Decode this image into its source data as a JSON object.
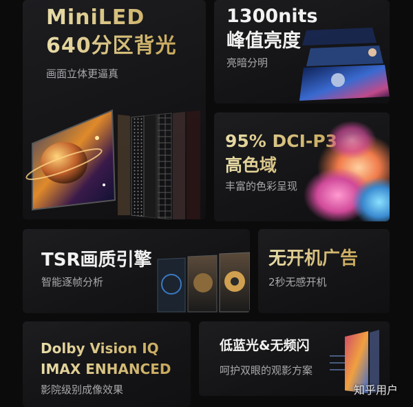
{
  "features": [
    {
      "title_line1": "MiniLED",
      "title_line2": "640分区背光",
      "subtitle": "画面立体更逼真"
    },
    {
      "title_line1": "1300nits",
      "title_line2": "峰值亮度",
      "subtitle": "亮暗分明"
    },
    {
      "title_line1": "95% DCI-P3",
      "title_line2": "高色域",
      "subtitle": "丰富的色彩呈现"
    },
    {
      "title": "TSR画质引擎",
      "subtitle": "智能逐帧分析"
    },
    {
      "title": "无开机广告",
      "subtitle": "2秒无感开机"
    },
    {
      "title_line1": "Dolby Vision IQ",
      "title_line2": "IMAX ENHANCED",
      "subtitle": "影院级别成像效果"
    },
    {
      "title": "低蓝光&无频闪",
      "subtitle": "呵护双眼的观影方案"
    }
  ],
  "watermark": "知乎用户",
  "colors": {
    "background": "#0b0b0c",
    "card": "#18181a",
    "gold": "#d9c57f",
    "subtitle": "#a9a9ad"
  }
}
